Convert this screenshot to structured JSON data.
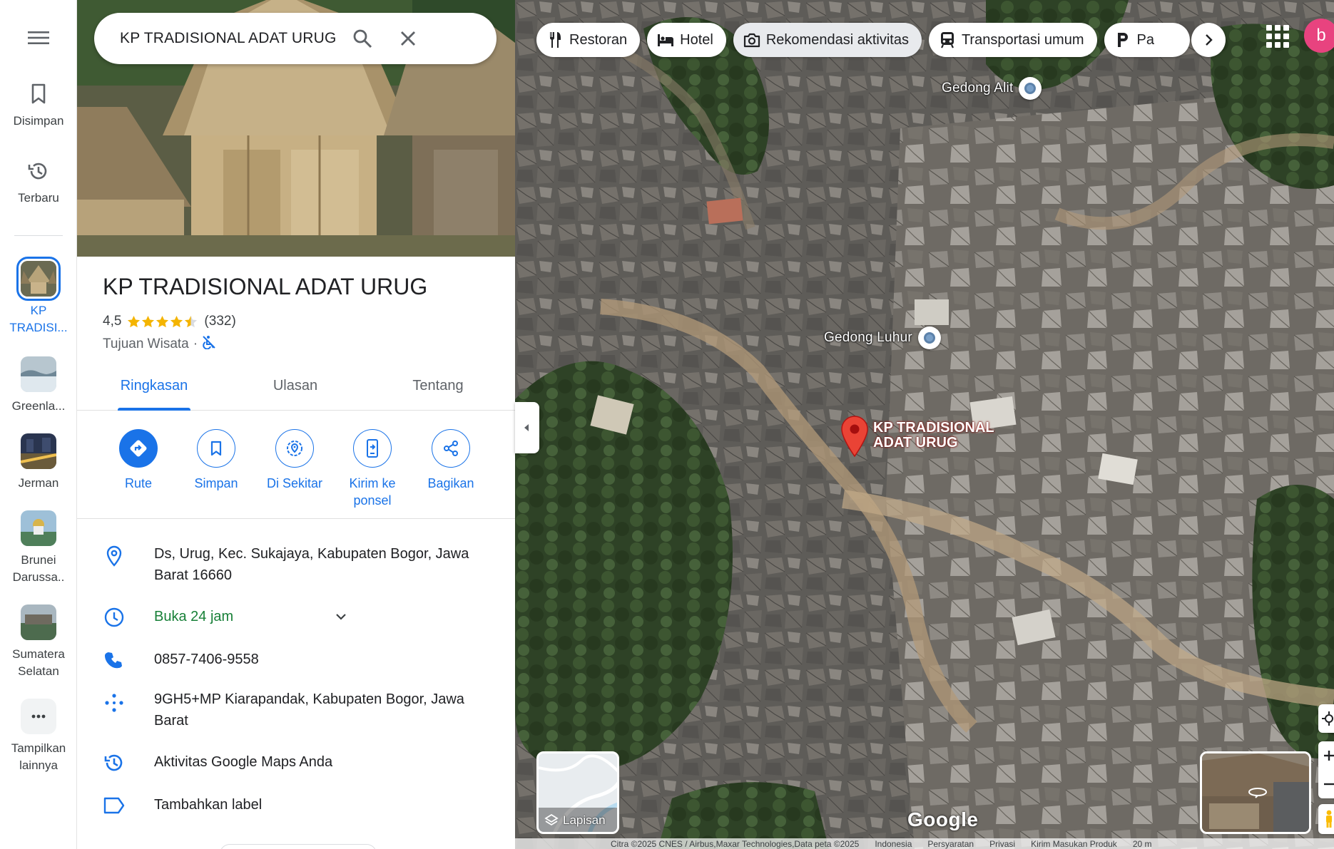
{
  "search": {
    "query": "KP TRADISIONAL ADAT URUG"
  },
  "rail": {
    "saved_label": "Disimpan",
    "recent_label": "Terbaru",
    "recents": [
      {
        "label": "KP TRADISI...",
        "active": true
      },
      {
        "label": "Greenla..."
      },
      {
        "label": "Jerman"
      },
      {
        "label": "Brunei Darussa.."
      },
      {
        "label": "Sumatera Selatan"
      }
    ],
    "more_label": "Tampilkan lainnya"
  },
  "place": {
    "title": "KP TRADISIONAL ADAT URUG",
    "rating": "4,5",
    "stars": 4.5,
    "reviews": "(332)",
    "category": "Tujuan Wisata",
    "separator": "·"
  },
  "tabs": [
    "Ringkasan",
    "Ulasan",
    "Tentang"
  ],
  "actions": [
    {
      "label": "Rute",
      "icon": "directions-icon"
    },
    {
      "label": "Simpan",
      "icon": "bookmark-icon"
    },
    {
      "label": "Di Sekitar",
      "icon": "nearby-icon"
    },
    {
      "label": "Kirim ke ponsel",
      "icon": "send-to-phone-icon"
    },
    {
      "label": "Bagikan",
      "icon": "share-icon"
    }
  ],
  "info": {
    "address": "Ds, Urug, Kec. Sukajaya, Kabupaten Bogor, Jawa Barat 16660",
    "hours": "Buka 24 jam",
    "phone": "0857-7406-9558",
    "plus_code": "9GH5+MP Kiarapandak, Kabupaten Bogor, Jawa Barat",
    "activity": "Aktivitas Google Maps Anda",
    "add_label": "Tambahkan label"
  },
  "map": {
    "chips": [
      {
        "label": "Restoran",
        "icon": "restaurant-icon"
      },
      {
        "label": "Hotel",
        "icon": "hotel-icon"
      },
      {
        "label": "Rekomendasi aktivitas",
        "icon": "camera-icon"
      },
      {
        "label": "Transportasi umum",
        "icon": "transit-icon"
      },
      {
        "label": "Pa",
        "icon": "parking-icon"
      }
    ],
    "avatar_letter": "b",
    "pois": [
      "Gedong Alit",
      "Gedong Luhur"
    ],
    "pin_label_line1": "KP TRADISIONAL",
    "pin_label_line2": "ADAT URUG",
    "layers_label": "Lapisan",
    "logo": "Google",
    "attribution": [
      "Citra ©2025 CNES / Airbus,Maxar Technologies,Data peta ©2025",
      "Indonesia",
      "Persyaratan",
      "Privasi",
      "Kirim Masukan Produk",
      "20 m"
    ]
  },
  "colors": {
    "accent": "#1a73e8",
    "open": "#188038",
    "pin": "#ea4335",
    "avatar": "#e8437f"
  }
}
